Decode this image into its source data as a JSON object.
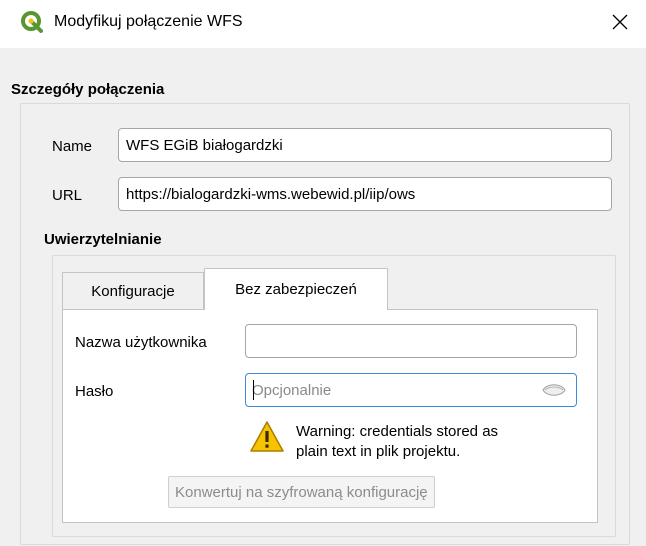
{
  "window": {
    "title": "Modyfikuj połączenie WFS"
  },
  "connection_details": {
    "title": "Szczegóły połączenia",
    "name_label": "Name",
    "name_value": "WFS EGiB białogardzki",
    "url_label": "URL",
    "url_value": "https://bialogardzki-wms.webewid.pl/iip/ows"
  },
  "authentication": {
    "title": "Uwierzytelnianie",
    "tabs": [
      {
        "label": "Konfiguracje",
        "active": false
      },
      {
        "label": "Bez zabezpieczeń",
        "active": true
      }
    ],
    "username_label": "Nazwa użytkownika",
    "username_value": "",
    "password_label": "Hasło",
    "password_placeholder": "Opcjonalnie",
    "warning_line1": "Warning: credentials stored as",
    "warning_line2": "plain text in plik projektu.",
    "convert_button": "Konwertuj na szyfrowaną konfigurację"
  },
  "colors": {
    "qgis_green": "#589632",
    "warning_yellow": "#f5c400",
    "focus_blue": "#3c8bd9"
  },
  "icons": {
    "app": "qgis-logo-icon",
    "close": "close-icon",
    "password_toggle": "eye-icon",
    "warning": "warning-icon"
  }
}
